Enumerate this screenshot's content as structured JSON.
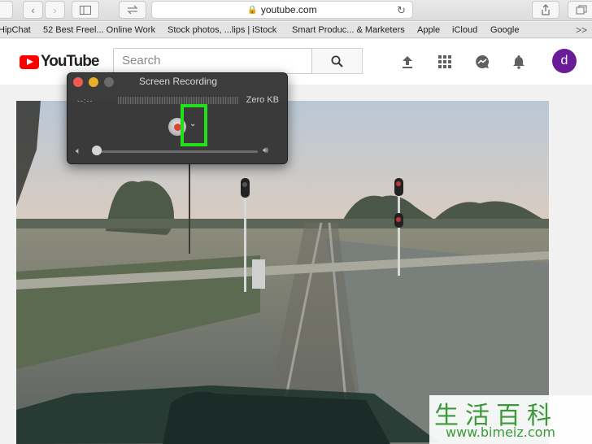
{
  "browser": {
    "address": "youtube.com",
    "bookmarks": [
      "HipChat",
      "52 Best Freel... Online Work",
      "Stock photos, ...lips | iStock",
      "Smart Produc... & Marketers",
      "Apple",
      "iCloud",
      "Google"
    ],
    "more_bookmarks": ">>"
  },
  "youtube": {
    "logo_text": "YouTube",
    "search_placeholder": "Search",
    "avatar_letter": "d",
    "colors": {
      "logo_red": "#ff0000",
      "avatar_bg": "#6a1b9a"
    }
  },
  "screen_recording": {
    "title": "Screen Recording",
    "time": "--:--",
    "size": "Zero KB",
    "options_chevron": "⌄",
    "volume": 0,
    "highlight_color": "#22e01a"
  },
  "watermark": {
    "chinese": "生活百科",
    "url": "www.bimeiz.com"
  }
}
